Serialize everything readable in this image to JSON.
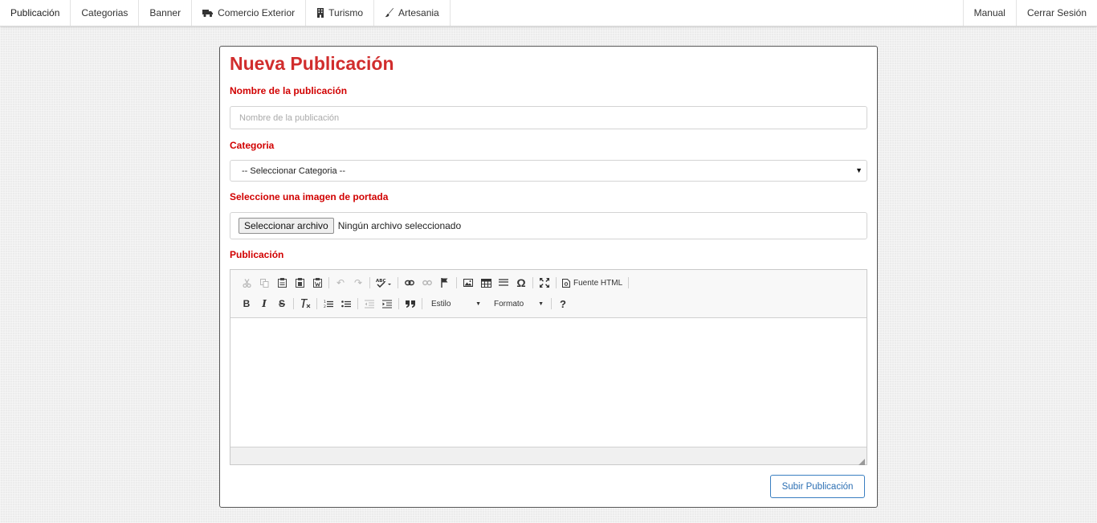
{
  "navbar": {
    "left_items": [
      {
        "label": "Publicación",
        "icon": ""
      },
      {
        "label": "Categorias",
        "icon": ""
      },
      {
        "label": "Banner",
        "icon": ""
      },
      {
        "label": "Comercio Exterior",
        "icon": "truck-icon"
      },
      {
        "label": "Turismo",
        "icon": "building-icon"
      },
      {
        "label": "Artesania",
        "icon": "brush-icon"
      }
    ],
    "right_items": [
      {
        "label": "Manual"
      },
      {
        "label": "Cerrar Sesión"
      }
    ]
  },
  "form": {
    "title": "Nueva Publicación",
    "name_label": "Nombre de la publicación",
    "name_placeholder": "Nombre de la publicación",
    "name_value": "",
    "category_label": "Categoria",
    "category_selected": "-- Seleccionar Categoria --",
    "image_label": "Seleccione una imagen de portada",
    "file_button": "Seleccionar archivo",
    "file_status": "Ningún archivo seleccionado",
    "publication_label": "Publicación",
    "submit_label": "Subir Publicación"
  },
  "editor": {
    "source_label": "Fuente HTML",
    "style_combo": "Estilo",
    "format_combo": "Formato",
    "help_label": "?",
    "omega_label": "Ω",
    "content": ""
  },
  "colors": {
    "title": "#d12d2d",
    "label": "#d10000",
    "submit_border": "#3a7fc1"
  }
}
